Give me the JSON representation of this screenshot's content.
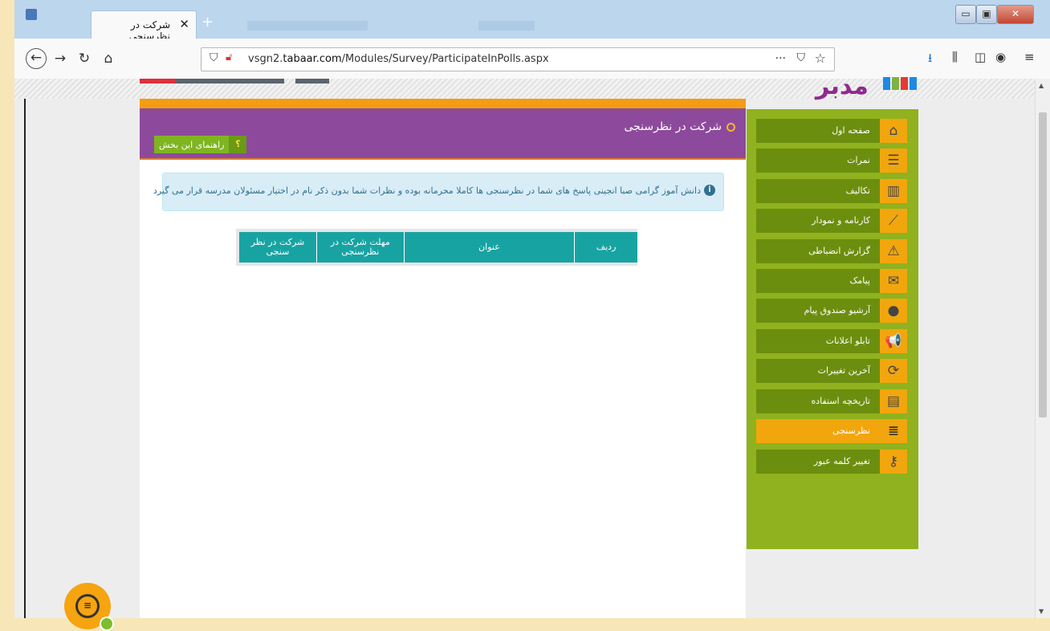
{
  "browser": {
    "tab_title": "شرکت در نظرسنجی",
    "tab_close": "✕",
    "new_tab": "+",
    "url_host_prefix": "vsgn2.",
    "url_host_domain": "tabaar.com",
    "url_path": "/Modules/Survey/ParticipateInPolls.aspx",
    "url_menu": "···",
    "window_controls": {
      "minimize": "▭",
      "maximize": "▣",
      "close": "✕"
    }
  },
  "page": {
    "logo_text": "مدبر",
    "title": "شرکت در نظرسنجی",
    "help_label": "راهنمای این بخش",
    "help_icon": "؟",
    "alert_text": "دانش آموز گرامی صبا انجینی پاسخ های شما در نظرسنجی ها کاملا محرمانه بوده و نظرات شما بدون ذکر نام در اختیار مسئولان مدرسه قرار می گیرد",
    "alert_icon": "i",
    "table": {
      "headers": [
        "ردیف",
        "عنوان",
        "مهلت شرکت در نظرسنجی",
        "شرکت در نظر سنجی"
      ]
    }
  },
  "sidebar": {
    "items": [
      {
        "label": "صفحه اول",
        "icon": "home-icon",
        "glyph": "⌂"
      },
      {
        "label": "نمرات",
        "icon": "list-numbered-icon",
        "glyph": "☰"
      },
      {
        "label": "تکالیف",
        "icon": "book-icon",
        "glyph": "▥"
      },
      {
        "label": "کارنامه و نمودار",
        "icon": "chart-line-icon",
        "glyph": "⟋"
      },
      {
        "label": "گزارش انضباطی",
        "icon": "warning-user-icon",
        "glyph": "⚠"
      },
      {
        "label": "پیامک",
        "icon": "envelope-icon",
        "glyph": "✉"
      },
      {
        "label": "آرشیو صندوق پیام",
        "icon": "chat-bubble-icon",
        "glyph": "●"
      },
      {
        "label": "تابلو اعلانات",
        "icon": "megaphone-icon",
        "glyph": "📢"
      },
      {
        "label": "آخرین تغییرات",
        "icon": "refresh-icon",
        "glyph": "⟳"
      },
      {
        "label": "تاریخچه استفاده",
        "icon": "archive-icon",
        "glyph": "▤"
      },
      {
        "label": "نظرسنجی",
        "icon": "poll-list-icon",
        "glyph": "≣",
        "active": true
      },
      {
        "label": "تغییر کلمه عبور",
        "icon": "key-icon",
        "glyph": "⚷"
      }
    ]
  },
  "colors": {
    "header_purple": "#8d4a9c",
    "sidebar_green": "#8fb21e",
    "menu_dark_green": "#6c8e0e",
    "accent_orange": "#f2a60d",
    "table_teal": "#18a3a3",
    "alert_blue": "#d9edf7"
  }
}
